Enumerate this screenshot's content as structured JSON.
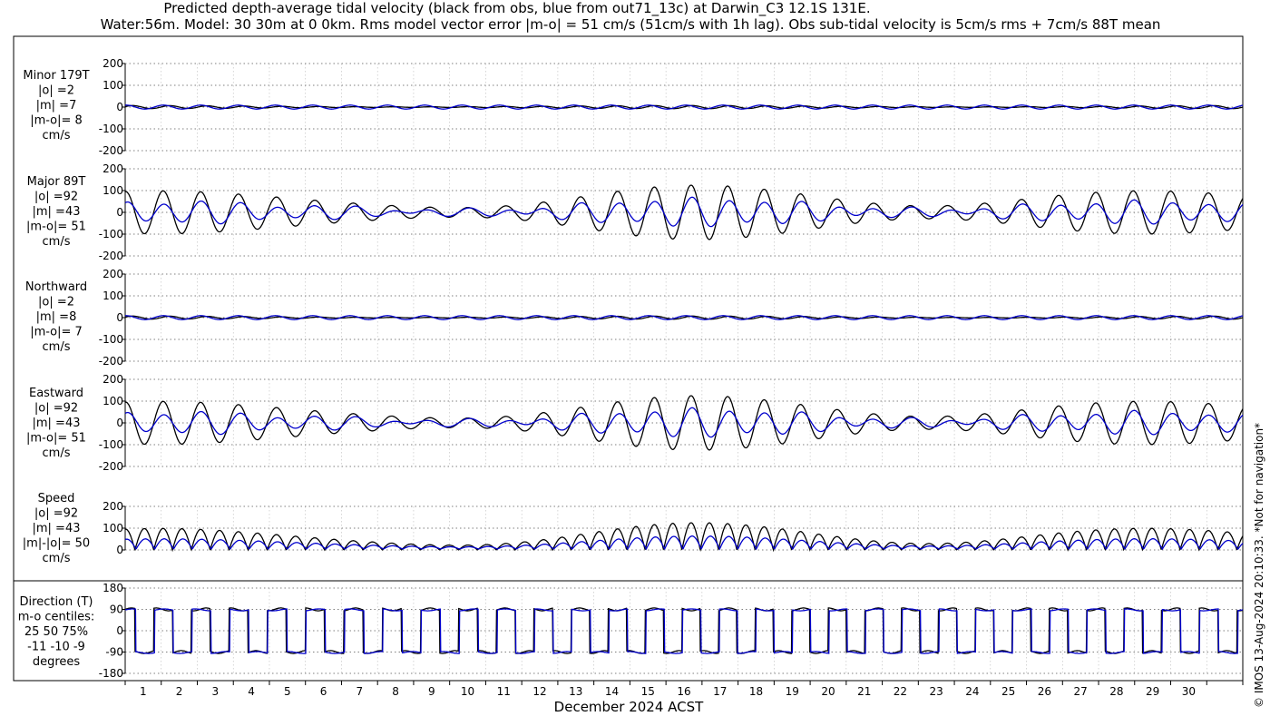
{
  "chart_data": {
    "type": "line",
    "title_line1": "Predicted depth-average tidal velocity (black from obs, blue from out71_13c) at Darwin_C3 12.1S 131E.",
    "title_line2": "Water:56m. Model: 30 30m at 0 0km. Rms model vector error |m-o| = 51 cm/s (51cm/s with 1h lag). Obs sub-tidal velocity is 5cm/s rms + 7cm/s 88T mean",
    "xlabel": "December 2024 ACST",
    "x_ticks": [
      "1",
      "2",
      "3",
      "4",
      "5",
      "6",
      "7",
      "8",
      "9",
      "10",
      "11",
      "12",
      "13",
      "14",
      "15",
      "16",
      "17",
      "18",
      "19",
      "20",
      "21",
      "22",
      "23",
      "24",
      "25",
      "26",
      "27",
      "28",
      "29",
      "30"
    ],
    "xlim": [
      0,
      31
    ],
    "grid": true,
    "series_colors": {
      "obs": "#000000",
      "model": "#0000cc"
    },
    "series": [
      {
        "name": "obs"
      },
      {
        "name": "model"
      }
    ],
    "panels": [
      {
        "id": "minor",
        "label": [
          "Minor 179T",
          "|o| =2",
          "|m| =7",
          "|m-o|= 8",
          "cm/s"
        ],
        "ylim": [
          -200,
          200
        ],
        "yticks": [
          "200",
          "100",
          "0",
          "-100",
          "-200"
        ],
        "amp_obs": 7,
        "amp_model": 9
      },
      {
        "id": "major",
        "label": [
          "Major 89T",
          "|o| =92",
          "|m| =43",
          "|m-o|= 51",
          "cm/s"
        ],
        "ylim": [
          -200,
          200
        ],
        "yticks": [
          "200",
          "100",
          "0",
          "-100",
          "-200"
        ],
        "amp_obs": 130,
        "amp_model": 62
      },
      {
        "id": "north",
        "label": [
          "Northward",
          "|o| =2",
          "|m| =8",
          "|m-o|= 7",
          "cm/s"
        ],
        "ylim": [
          -200,
          200
        ],
        "yticks": [
          "200",
          "100",
          "0",
          "-100",
          "-200"
        ],
        "amp_obs": 7,
        "amp_model": 9
      },
      {
        "id": "east",
        "label": [
          "Eastward",
          "|o| =92",
          "|m| =43",
          "|m-o|= 51",
          "cm/s"
        ],
        "ylim": [
          -200,
          200
        ],
        "yticks": [
          "200",
          "100",
          "0",
          "-100",
          "-200"
        ],
        "amp_obs": 130,
        "amp_model": 62
      },
      {
        "id": "speed",
        "label": [
          "Speed",
          "|o| =92",
          "|m| =43",
          "|m|-|o|= 50",
          "cm/s"
        ],
        "ylim": [
          0,
          200
        ],
        "yticks": [
          "200",
          "100",
          "0"
        ],
        "amp_obs": 130,
        "amp_model": 62
      },
      {
        "id": "direction",
        "label": [
          "Direction (T)",
          "m-o centiles:",
          "25  50  75%",
          "-11  -10  -9",
          "degrees"
        ],
        "ylim": [
          -180,
          180
        ],
        "yticks": [
          "180",
          "90",
          "0",
          "-90",
          "-180"
        ]
      }
    ]
  },
  "copyright": "© IMOS 13-Aug-2024 20:10:33. *Not for navigation*"
}
